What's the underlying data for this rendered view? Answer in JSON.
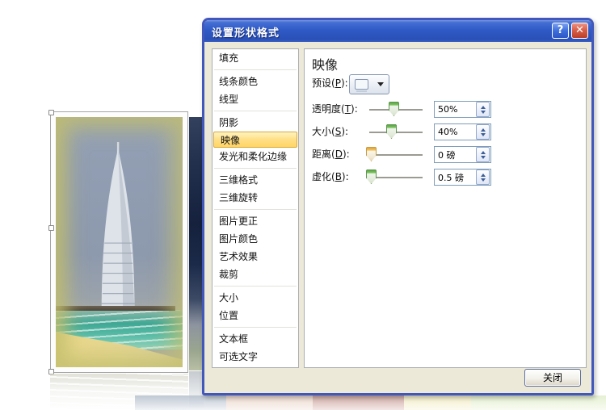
{
  "dialog": {
    "title": "设置形状格式",
    "help_glyph": "?",
    "close_glyph": "✕"
  },
  "sidebar": {
    "items": [
      {
        "label": "填充",
        "selected": false
      },
      {
        "label": "线条颜色",
        "selected": false
      },
      {
        "label": "线型",
        "selected": false
      },
      {
        "label": "阴影",
        "selected": false
      },
      {
        "label": "映像",
        "selected": true
      },
      {
        "label": "发光和柔化边缘",
        "selected": false
      },
      {
        "label": "三维格式",
        "selected": false
      },
      {
        "label": "三维旋转",
        "selected": false
      },
      {
        "label": "图片更正",
        "selected": false
      },
      {
        "label": "图片颜色",
        "selected": false
      },
      {
        "label": "艺术效果",
        "selected": false
      },
      {
        "label": "裁剪",
        "selected": false
      },
      {
        "label": "大小",
        "selected": false
      },
      {
        "label": "位置",
        "selected": false
      },
      {
        "label": "文本框",
        "selected": false
      },
      {
        "label": "可选文字",
        "selected": false
      }
    ]
  },
  "panel": {
    "heading": "映像",
    "preset": {
      "pre": "预设(",
      "key": "P",
      "post": "):"
    },
    "controls": [
      {
        "id": "transparency",
        "pre": "透明度(",
        "key": "T",
        "post": "):",
        "value": "50%",
        "slider_pct": 50,
        "thumb_color": "green"
      },
      {
        "id": "size",
        "pre": "大小(",
        "key": "S",
        "post": "):",
        "value": "40%",
        "slider_pct": 40,
        "thumb_color": "green"
      },
      {
        "id": "distance",
        "pre": "距离(",
        "key": "D",
        "post": "):",
        "value": "0 磅",
        "slider_pct": 0,
        "thumb_color": "orange"
      },
      {
        "id": "blur",
        "pre": "虚化(",
        "key": "B",
        "post": "):",
        "value": "0.5 磅",
        "slider_pct": 0,
        "thumb_color": "green"
      }
    ]
  },
  "footer": {
    "close": "关闭"
  },
  "colors": {
    "dialog_bg": "#ECE9D8",
    "titlebar_blue": "#2F5AC6",
    "selected_item_bg": "#FFD564",
    "selected_item_border": "#D8A838",
    "thumb_green": "#6FBF5A",
    "thumb_orange": "#E8A33D",
    "spinner_arrow": "#3C5E98"
  }
}
